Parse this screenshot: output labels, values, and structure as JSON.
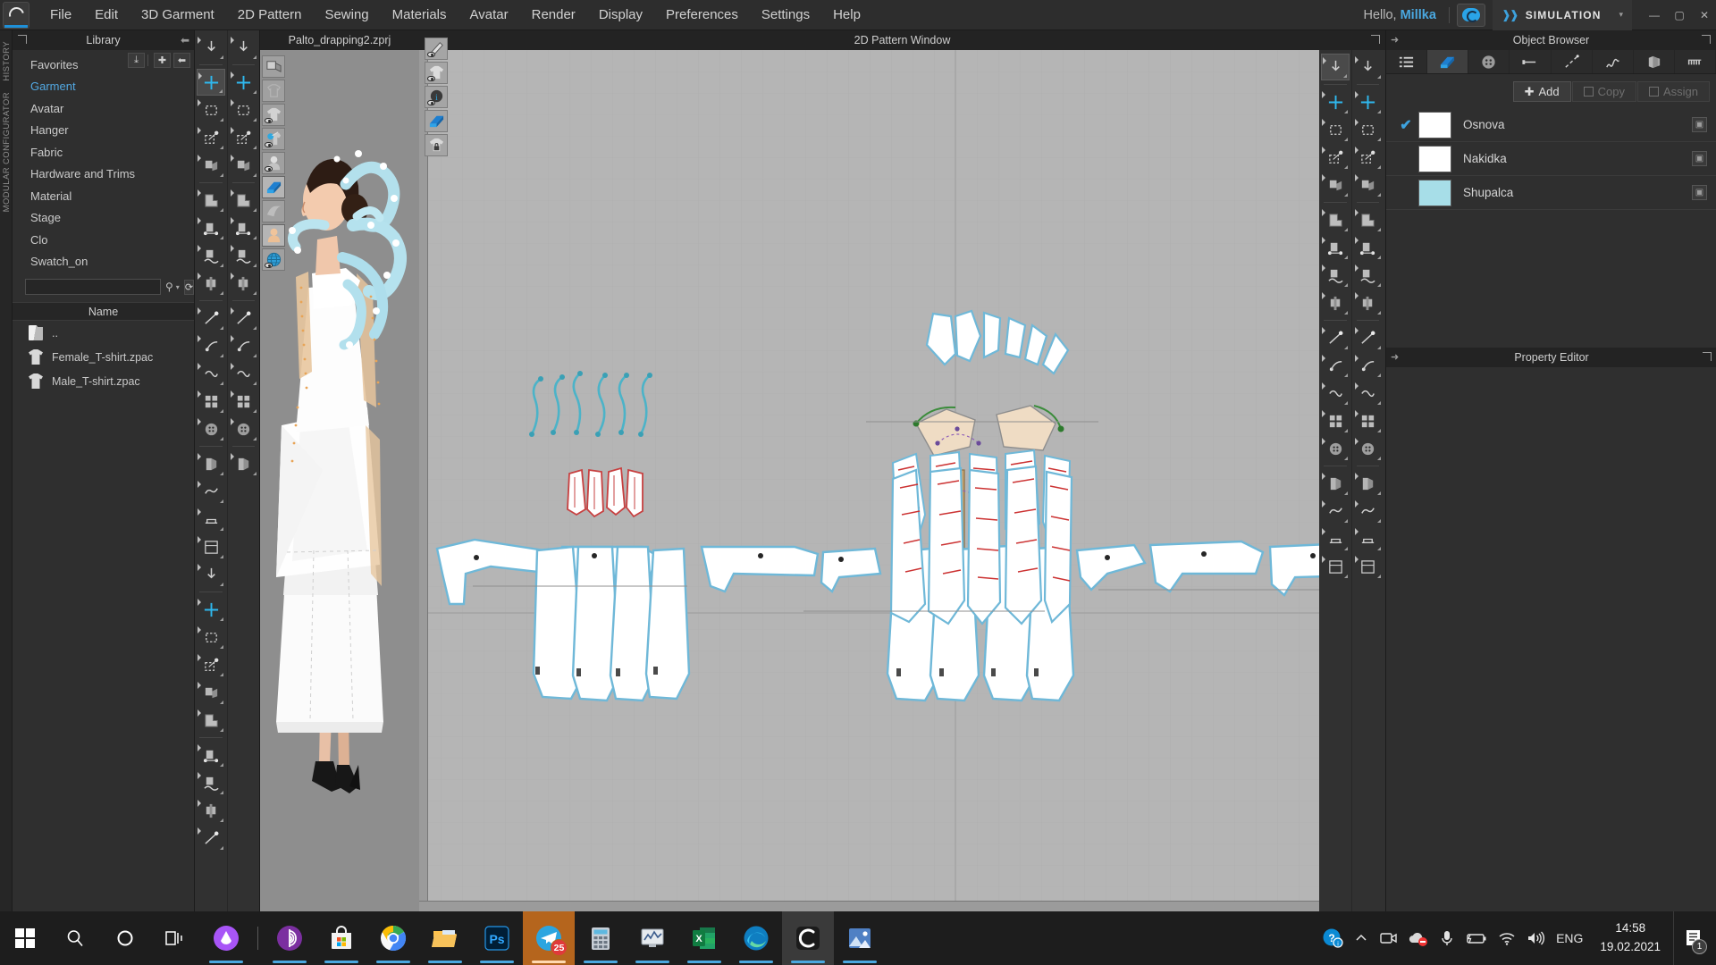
{
  "app": {
    "menu_items": [
      "File",
      "Edit",
      "3D Garment",
      "2D Pattern",
      "Sewing",
      "Materials",
      "Avatar",
      "Render",
      "Display",
      "Preferences",
      "Settings",
      "Help"
    ],
    "logo_icon": "clo-logo-icon",
    "greeting_prefix": "Hello,",
    "user_name": "Millka",
    "cloud_icon": "clo-cloud-icon",
    "mode_label": "SIMULATION",
    "mode_caret": "▾",
    "window_controls": {
      "minimize": "—",
      "maximize": "▢",
      "close": "✕"
    }
  },
  "vertical_tabs": [
    "HISTORY",
    "MODULAR CONFIGURATOR"
  ],
  "library": {
    "title": "Library",
    "expand_icon": "expand-icon",
    "collapse_icon": "collapse-left-icon",
    "actions": [
      {
        "name": "download-icon",
        "glyph": "⤓"
      },
      {
        "name": "add-icon",
        "glyph": "✚"
      },
      {
        "name": "back-icon",
        "glyph": "⬅"
      }
    ],
    "items": [
      {
        "label": "Favorites",
        "active": false
      },
      {
        "label": "Garment",
        "active": true
      },
      {
        "label": "Avatar",
        "active": false
      },
      {
        "label": "Hanger",
        "active": false
      },
      {
        "label": "Fabric",
        "active": false
      },
      {
        "label": "Hardware and Trims",
        "active": false
      },
      {
        "label": "Material",
        "active": false
      },
      {
        "label": "Stage",
        "active": false
      },
      {
        "label": "Clo",
        "active": false
      },
      {
        "label": "Swatch_on",
        "active": false
      }
    ],
    "search": {
      "value": "",
      "placeholder": "",
      "search_icon": "search-icon",
      "caret": "▾"
    },
    "search_buttons": [
      {
        "name": "refresh-icon",
        "glyph": "⟳"
      },
      {
        "name": "grid-view-icon",
        "glyph": "⠿"
      }
    ],
    "column_header": "Name",
    "files": [
      {
        "name": "..",
        "icon": "folder-icon"
      },
      {
        "name": "Female_T-shirt.zpac",
        "icon": "shirt-icon"
      },
      {
        "name": "Male_T-shirt.zpac",
        "icon": "shirt-icon"
      }
    ]
  },
  "tool_rail": {
    "left_column": [
      {
        "name": "transform-down-icon",
        "selected": false
      },
      {
        "name": "move-gizmo-icon",
        "selected": true
      },
      {
        "name": "rectangle-select-icon",
        "selected": false
      },
      {
        "name": "edit-point-icon",
        "selected": false
      },
      {
        "name": "fold-arrange-icon",
        "selected": false
      },
      {
        "name": "pattern-copy-icon",
        "selected": false
      },
      {
        "name": "pattern-measure-icon",
        "selected": false
      },
      {
        "name": "pattern-curve-icon",
        "selected": false
      },
      {
        "name": "pattern-pin-icon",
        "selected": false
      },
      {
        "name": "line-segment-icon",
        "selected": false
      },
      {
        "name": "sew-free-icon",
        "selected": false
      },
      {
        "name": "sew-segment-icon",
        "selected": false
      },
      {
        "name": "sew-multi-icon",
        "selected": false
      },
      {
        "name": "fold-line-icon",
        "selected": false
      },
      {
        "name": "button-icon",
        "selected": false
      },
      {
        "name": "buttonhole-icon",
        "selected": false
      },
      {
        "name": "zipper-icon",
        "selected": false
      },
      {
        "name": "topstitch-icon",
        "selected": false
      },
      {
        "name": "trim-icon",
        "selected": false
      },
      {
        "name": "pleat-icon",
        "selected": false
      },
      {
        "name": "graphic-icon",
        "selected": false
      },
      {
        "name": "puckering-icon",
        "selected": false
      },
      {
        "name": "elastic-icon",
        "selected": false
      },
      {
        "name": "measure-tape-icon",
        "selected": false
      },
      {
        "name": "snap-icon",
        "selected": false
      },
      {
        "name": "avatar-pose-icon",
        "selected": false
      },
      {
        "name": "ruler-3d-icon",
        "selected": false
      },
      {
        "name": "circumference-icon",
        "selected": false
      }
    ],
    "right_column": [
      {
        "name": "walk-avatar-icon",
        "selected": false
      },
      {
        "name": "curve-edit-icon",
        "selected": false
      },
      {
        "name": "curve-point-icon",
        "selected": false
      },
      {
        "name": "curve-smooth-icon",
        "selected": false
      },
      {
        "name": "pattern-3d-icon",
        "selected": false
      },
      {
        "name": "checker-pattern-icon",
        "selected": false
      },
      {
        "name": "texture-icon",
        "selected": false
      },
      {
        "name": "fabric-ball-icon",
        "selected": false
      },
      {
        "name": "dart-icon",
        "selected": false
      },
      {
        "name": "scissors-icon",
        "selected": false
      },
      {
        "name": "slash-spread-icon",
        "selected": false
      },
      {
        "name": "tape-icon",
        "selected": false
      },
      {
        "name": "zipper2-icon",
        "selected": false
      },
      {
        "name": "trim2-icon",
        "selected": false
      },
      {
        "name": "print-layout-icon",
        "selected": false
      }
    ]
  },
  "view3d": {
    "tools": [
      {
        "name": "box-shadow-icon",
        "selected": false
      },
      {
        "name": "garment-ghost-icon",
        "selected": false
      },
      {
        "name": "show-garment-icon",
        "selected": false
      },
      {
        "name": "show-pin-icon",
        "selected": false
      },
      {
        "name": "show-avatar-icon",
        "selected": false
      },
      {
        "name": "fabric-book-icon",
        "selected": true
      },
      {
        "name": "fabric-drape-icon",
        "selected": false
      },
      {
        "name": "skin-icon",
        "selected": true
      },
      {
        "name": "globe-env-icon",
        "selected": false
      }
    ],
    "avatar_alt": "3d-avatar-white-coat"
  },
  "pattern2d": {
    "file_tab": "Palto_drapping2.zprj",
    "file_tab_expand_icon": "expand-icon",
    "title": "2D Pattern Window",
    "left_tools": [
      {
        "name": "pen-visibility-icon",
        "selected": false
      },
      {
        "name": "pattern-visibility-icon",
        "selected": false
      },
      {
        "name": "info-visibility-icon",
        "selected": false
      },
      {
        "name": "fabric-visibility-icon",
        "selected": true
      },
      {
        "name": "lock-pattern-icon",
        "selected": false
      }
    ],
    "right_tools_col1": [
      {
        "name": "polygon-fill-icon",
        "selected": true
      },
      {
        "name": "angle-edit-icon",
        "selected": false
      },
      {
        "name": "curve-spline-icon",
        "selected": false
      },
      {
        "name": "curve-handle-icon",
        "selected": false
      },
      {
        "name": "segment-length-icon",
        "selected": false
      },
      {
        "name": "cross-cut-icon",
        "selected": false
      },
      {
        "name": "triangle-edit-icon",
        "selected": false
      },
      {
        "name": "dart-tool-icon",
        "selected": false
      },
      {
        "name": "shape-fill-icon",
        "selected": false
      },
      {
        "name": "outline-shape-icon",
        "selected": false
      },
      {
        "name": "dashed-select-icon",
        "selected": false
      },
      {
        "name": "shield-shape-icon",
        "selected": false
      },
      {
        "name": "grid-layout-icon",
        "selected": false
      },
      {
        "name": "columns-icon",
        "selected": false
      },
      {
        "name": "nest-icon",
        "selected": false
      },
      {
        "name": "print-icon",
        "selected": false
      },
      {
        "name": "label-icon",
        "selected": false
      },
      {
        "name": "flag-icon",
        "selected": false
      }
    ],
    "right_tools_col2": [
      {
        "name": "pattern-copy2-icon",
        "selected": false
      },
      {
        "name": "pattern-measure2-icon",
        "selected": false
      },
      {
        "name": "pattern-wave-icon",
        "selected": false
      },
      {
        "name": "pattern-search-icon",
        "selected": false
      },
      {
        "name": "iron-icon",
        "selected": false
      },
      {
        "name": "tshirt-icon",
        "selected": false
      },
      {
        "name": "fold-fabric-icon",
        "selected": false
      },
      {
        "name": "button-shirt-icon",
        "selected": false
      },
      {
        "name": "checker-shirt-icon",
        "selected": false
      },
      {
        "name": "line-dash-icon",
        "selected": false
      },
      {
        "name": "text-a-icon",
        "selected": false
      },
      {
        "name": "text-a2-icon",
        "selected": false
      },
      {
        "name": "spring-icon",
        "selected": false
      },
      {
        "name": "spring2-icon",
        "selected": false
      },
      {
        "name": "zigzag-icon",
        "selected": false
      },
      {
        "name": "ruler2-icon",
        "selected": false
      },
      {
        "name": "ruler3-icon",
        "selected": false
      },
      {
        "name": "camera-icon",
        "selected": false
      }
    ]
  },
  "object_browser": {
    "title": "Object Browser",
    "pin_icon": "pin-right-icon",
    "expand_icon": "expand-icon",
    "tabs": [
      {
        "name": "list-view-tab",
        "selected": false
      },
      {
        "name": "fabric-tab",
        "selected": true
      },
      {
        "name": "button-tab",
        "selected": false
      },
      {
        "name": "zipper-tab",
        "selected": false
      },
      {
        "name": "topstitch-tab",
        "selected": false
      },
      {
        "name": "puckering-tab",
        "selected": false
      },
      {
        "name": "fold-tab",
        "selected": false
      },
      {
        "name": "trim-tab",
        "selected": false
      }
    ],
    "add_label": "Add",
    "copy_label": "Copy",
    "assign_label": "Assign",
    "rows": [
      {
        "checked": true,
        "color": "#ffffff",
        "name": "Osnova",
        "action_icon": "assign-icon"
      },
      {
        "checked": false,
        "color": "#ffffff",
        "name": "Nakidka",
        "action_icon": "assign-icon"
      },
      {
        "checked": false,
        "color": "#a7dee8",
        "name": "Shupalca",
        "action_icon": "assign-icon"
      }
    ]
  },
  "property_editor": {
    "title": "Property Editor",
    "pin_icon": "pin-right-icon",
    "expand_icon": "expand-icon"
  },
  "taskbar": {
    "start_icon": "windows-start-icon",
    "system_icons": [
      {
        "name": "search-icon",
        "glyph": "search"
      },
      {
        "name": "cortana-icon",
        "glyph": "circle"
      },
      {
        "name": "task-view-icon",
        "glyph": "taskview"
      }
    ],
    "apps": [
      {
        "name": "yandex-browser",
        "color": "#a855f7",
        "running": true
      },
      {
        "name": "tor-browser",
        "color": "#7b2fa0",
        "running": true
      },
      {
        "name": "microsoft-store",
        "color": "#e8e8e8",
        "running": true
      },
      {
        "name": "google-chrome",
        "color": "#4285f4",
        "running": true
      },
      {
        "name": "file-explorer",
        "color": "#f5c242",
        "running": true
      },
      {
        "name": "photoshop",
        "color": "#001e36",
        "running": true
      },
      {
        "name": "telegram",
        "color": "#2ca5e0",
        "running": true,
        "badge": "25",
        "active": true
      },
      {
        "name": "calculator",
        "color": "#7d8fa0",
        "running": true
      },
      {
        "name": "task-manager",
        "color": "#d6dbe0",
        "running": true
      },
      {
        "name": "microsoft-excel",
        "color": "#217346",
        "running": true
      },
      {
        "name": "microsoft-edge",
        "color": "#0f7ec1",
        "running": true
      },
      {
        "name": "clo3d",
        "color": "#1b1b1b",
        "running": true,
        "active": true
      },
      {
        "name": "photos",
        "color": "#3f72b5",
        "running": true
      }
    ],
    "tray": [
      {
        "name": "help-support-icon"
      },
      {
        "name": "show-hidden-icons-icon"
      },
      {
        "name": "camera-icon"
      },
      {
        "name": "onedrive-blocked-icon"
      },
      {
        "name": "microphone-icon"
      },
      {
        "name": "battery-charging-icon"
      },
      {
        "name": "wifi-icon"
      },
      {
        "name": "volume-icon"
      }
    ],
    "language": "ENG",
    "time": "14:58",
    "date": "19.02.2021",
    "notification_count": "1",
    "notification_icon": "notifications-icon"
  }
}
